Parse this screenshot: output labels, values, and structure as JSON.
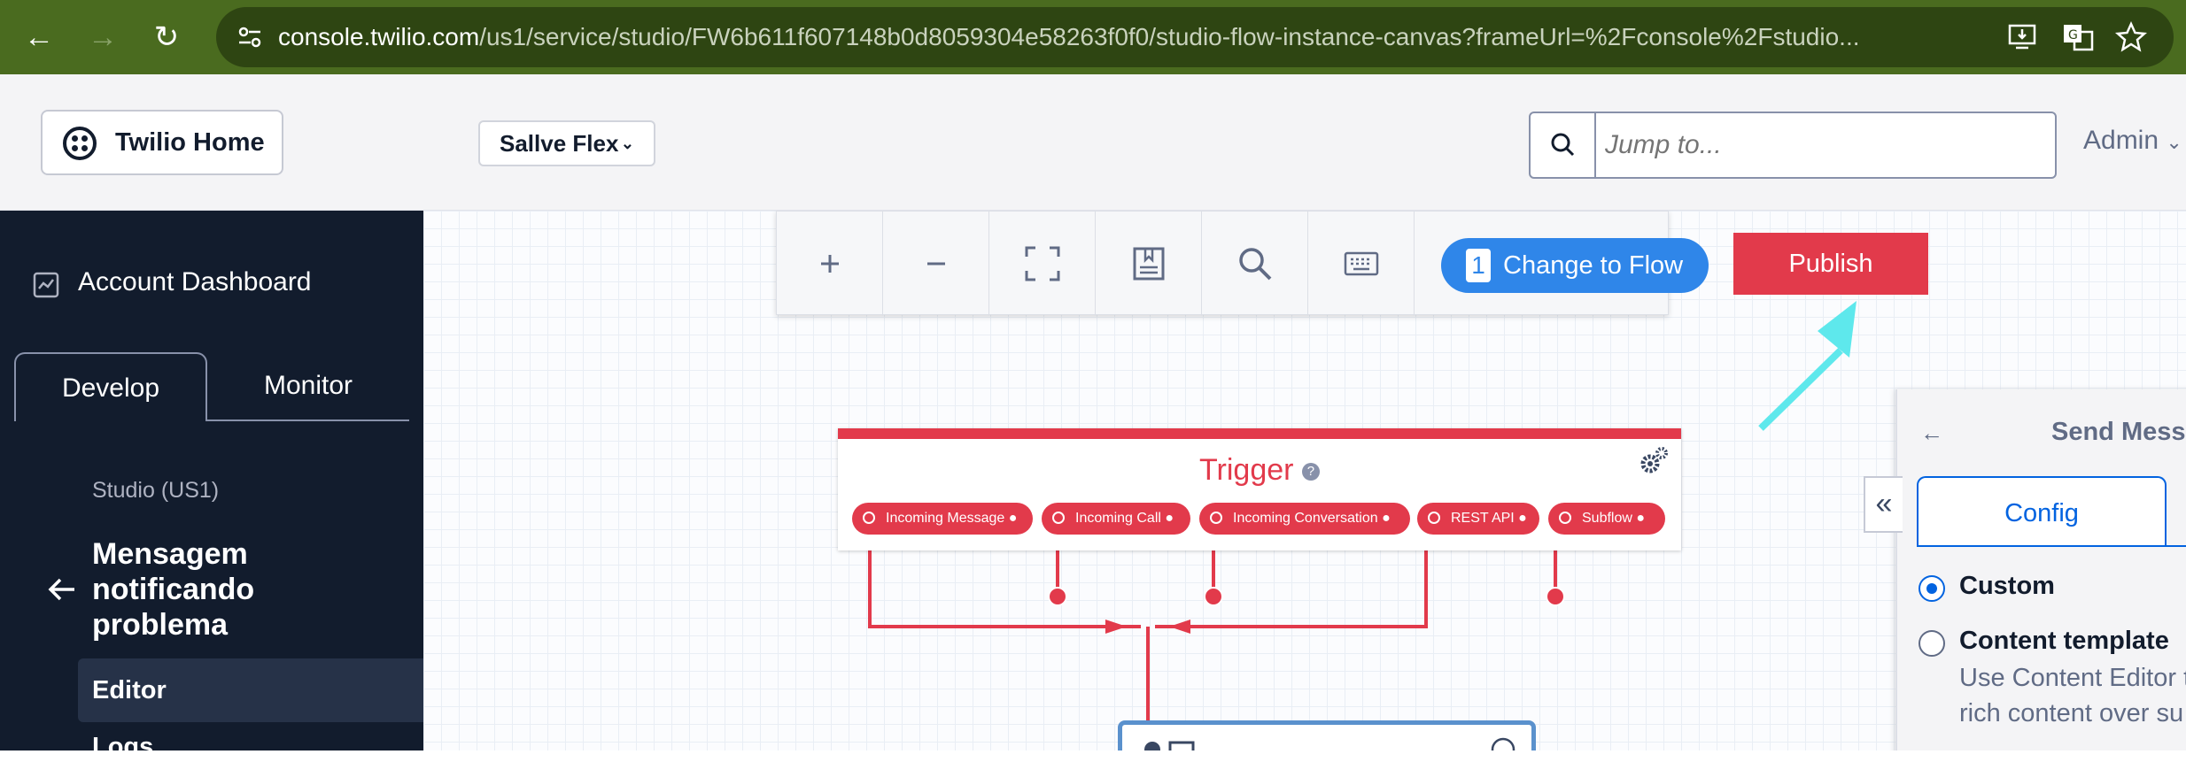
{
  "browser": {
    "url_host": "console.twilio.com",
    "url_path": "/us1/service/studio/FW6b611f607148b0d8059304e58263f0f0/studio-flow-instance-canvas?frameUrl=%2Fconsole%2Fstudio..."
  },
  "header": {
    "home_label": "Twilio Home",
    "account_name": "Sallve Flex",
    "search_placeholder": "Jump to...",
    "user_label": "Admin"
  },
  "sidebar": {
    "dashboard_label": "Account Dashboard",
    "tabs": [
      "Develop",
      "Monitor"
    ],
    "service_label": "Studio (US1)",
    "flow_name": "Mensagem notificando problema",
    "active_item": "Editor",
    "next_item": "Logs"
  },
  "toolbar": {
    "icons": [
      "zoom-in-icon",
      "zoom-out-icon",
      "fit-screen-icon",
      "notes-icon",
      "search-icon",
      "keyboard-icon"
    ],
    "change_count": "1",
    "change_label": "Change to Flow",
    "publish_label": "Publish"
  },
  "trigger": {
    "title": "Trigger",
    "events": [
      "Incoming Message",
      "Incoming Call",
      "Incoming Conversation",
      "REST API",
      "Subflow"
    ]
  },
  "panel": {
    "title": "Send Mess",
    "tab_label": "Config",
    "option_custom": "Custom",
    "option_template": "Content template",
    "template_help_line1": "Use Content Editor t",
    "template_help_line2": "rich content over su"
  },
  "colors": {
    "browser_bar": "#4a6b1f",
    "sidebar": "#121c2d",
    "publish": "#e23a4b",
    "change_button": "#2f86e9",
    "annotation_arrow": "#5ee8ec"
  }
}
